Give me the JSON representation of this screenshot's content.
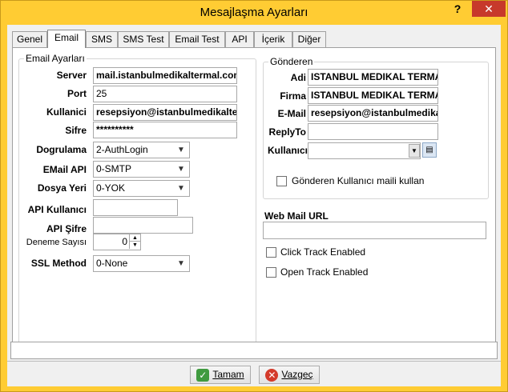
{
  "window": {
    "title": "Mesajlaşma Ayarları",
    "help_label": "?",
    "close_label": "✕"
  },
  "tabs": [
    "Genel",
    "Email",
    "SMS",
    "SMS Test",
    "Email Test",
    "API",
    "İçerik",
    "Diğer"
  ],
  "active_tab": "Email",
  "email_settings": {
    "legend": "Email Ayarları",
    "server_label": "Server",
    "server_value": "mail.istanbulmedikaltermal.com",
    "port_label": "Port",
    "port_value": "25",
    "user_label": "Kullanici",
    "user_value": "resepsiyon@istanbulmedikalten",
    "password_label": "Sifre",
    "password_value": "**********",
    "auth_label": "Dogrulama",
    "auth_value": "2-AuthLogin",
    "api_label": "EMail API",
    "api_value": "0-SMTP",
    "file_label": "Dosya Yeri",
    "file_value": "0-YOK",
    "api_user_label": "API Kullanıcı",
    "api_user_value": "",
    "api_password_label": "API Şifre",
    "api_password_value": "",
    "retry_label": "Deneme Sayısı",
    "retry_value": "0",
    "ssl_label": "SSL Method",
    "ssl_value": "0-None"
  },
  "sender": {
    "legend": "Gönderen",
    "name_label": "Adi",
    "name_value": "ISTANBUL MEDIKAL TERMA",
    "company_label": "Firma",
    "company_value": "ISTANBUL MEDIKAL TERMA",
    "email_label": "E-Mail",
    "email_value": "resepsiyon@istanbulmedikal",
    "replyto_label": "ReplyTo",
    "replyto_value": "",
    "user_label": "Kullanıcı",
    "user_value": "",
    "use_user_mail_label": "Gönderen Kullanıcı maili kullan",
    "use_user_mail_checked": false
  },
  "webmail": {
    "label": "Web Mail URL",
    "value": ""
  },
  "tracking": {
    "click_label": "Click Track Enabled",
    "click_checked": false,
    "open_label": "Open Track Enabled",
    "open_checked": false
  },
  "buttons": {
    "ok_label": "Tamam",
    "cancel_label": "Vazgeç"
  },
  "icons": {
    "ok": "check-icon",
    "cancel": "cancel-icon",
    "lookup": "lookup-icon"
  }
}
